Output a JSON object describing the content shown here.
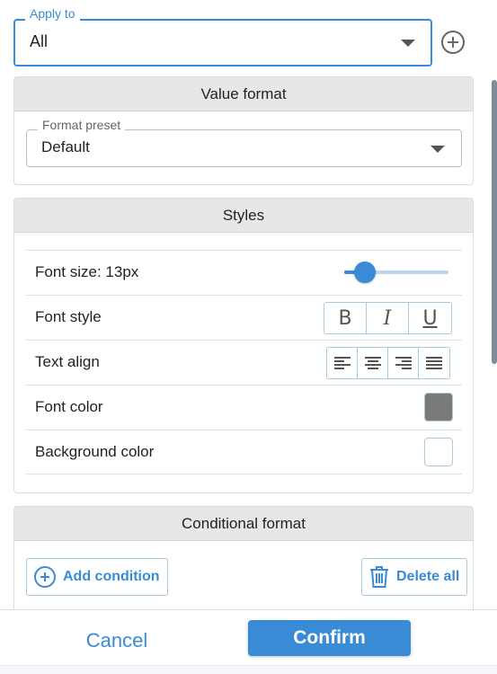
{
  "apply_to": {
    "label": "Apply to",
    "value": "All",
    "add_icon": "add-circle-icon"
  },
  "value_format": {
    "title": "Value format",
    "preset_label": "Format preset",
    "preset_value": "Default"
  },
  "styles": {
    "title": "Styles",
    "font_size_label": "Font size: 13px",
    "font_size_slider_level": 0.2,
    "font_style_label": "Font style",
    "font_style_buttons": [
      "B",
      "I",
      "U"
    ],
    "text_align_label": "Text align",
    "text_align_icons": [
      "align-left-icon",
      "align-center-icon",
      "align-right-icon",
      "align-justify-icon"
    ],
    "font_color_label": "Font color",
    "font_color": "#7a7a7a",
    "background_color_label": "Background color",
    "background_color": "#ffffff"
  },
  "conditional_format": {
    "title": "Conditional format",
    "add_condition_label": "Add condition",
    "delete_all_label": "Delete all"
  },
  "footer": {
    "cancel_label": "Cancel",
    "confirm_label": "Confirm"
  },
  "colors": {
    "accent": "#3a8bd6",
    "panel_header": "#e7e7e7"
  }
}
